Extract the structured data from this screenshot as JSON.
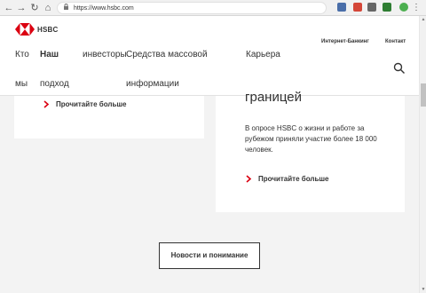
{
  "browser": {
    "url": "https://www.hsbc.com",
    "back_glyph": "←",
    "forward_glyph": "→",
    "reload_glyph": "↻",
    "home_glyph": "⌂",
    "lock_glyph": "🔒",
    "menu_glyph": "⋮",
    "extension_colors": [
      "#4a6ea9",
      "#d44638",
      "#666666",
      "#2e7d32"
    ]
  },
  "header": {
    "logo_text": "HSBC",
    "brand_color": "#db0011",
    "utility_links": [
      "Интернет-Банкинг",
      "Контакт"
    ],
    "nav": [
      "Кто",
      "Наш",
      "инвесторы",
      "Средства массовой",
      "Карьера",
      "мы",
      "подход",
      "информации"
    ],
    "search_icon": "search-icon"
  },
  "content": {
    "card_left_read_more": "Прочитайте больше",
    "heading": "границей",
    "paragraph": "В опросе HSBC о жизни и работе за рубежом приняли участие более 18 000 человек.",
    "card_right_read_more": "Прочитайте больше",
    "news_button": "Новости и понимание"
  }
}
